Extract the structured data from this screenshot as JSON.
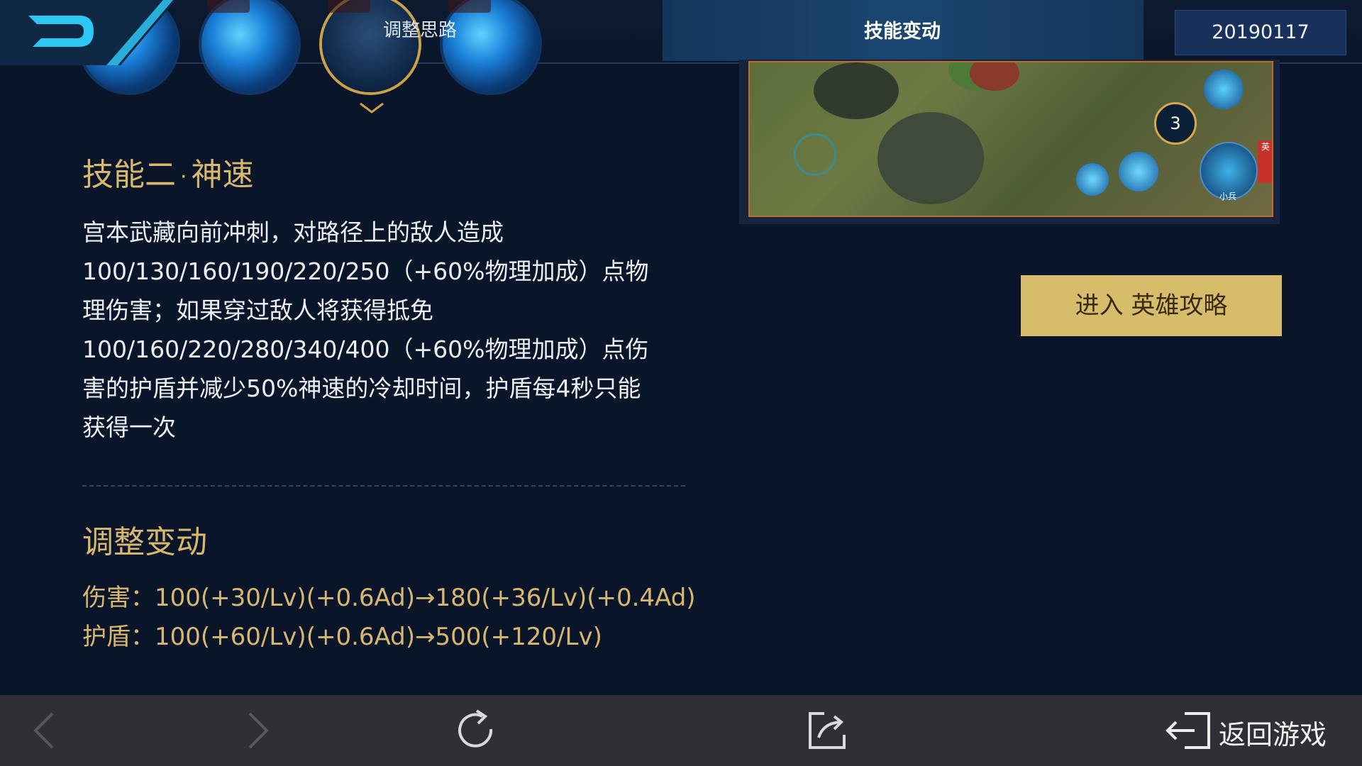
{
  "header": {
    "tabs": [
      {
        "label": "调整思路",
        "active": false
      },
      {
        "label": "技能变动",
        "active": true
      }
    ],
    "date": "20190117",
    "logo_icon": "d-logo-icon"
  },
  "skills_bar": {
    "icons": [
      "skill-1-icon",
      "skill-2-icon",
      "skill-3-icon",
      "skill-4-icon"
    ],
    "selected_index": 2
  },
  "skill": {
    "title": "技能二",
    "separator": "·",
    "name": "神速",
    "description_lines": [
      "宫本武藏向前冲刺，对路径上的敌人造成",
      "100/130/160/190/220/250（+60%物理加成）点物",
      "理伤害；如果穿过敌人将获得抵免",
      "100/160/220/280/340/400（+60%物理加成）点伤",
      "害的护盾并减少50%神速的冷却时间，护盾每4秒只能",
      "获得一次"
    ]
  },
  "adjustment": {
    "title": "调整变动",
    "lines": [
      "伤害：100(+30/Lv)(+0.6Ad)→180(+36/Lv)(+0.4Ad)",
      "护盾：100(+60/Lv)(+0.6Ad)→500(+120/Lv)"
    ]
  },
  "video": {
    "counter": "3",
    "label": "小兵",
    "side_label": "英"
  },
  "actions": {
    "enter_strategy": "进入 英雄攻略"
  },
  "bottom_nav": {
    "back_icon": "chevron-left-icon",
    "forward_icon": "chevron-right-icon",
    "refresh_icon": "refresh-icon",
    "share_icon": "share-icon",
    "return_icon": "exit-icon",
    "return_label": "返回游戏"
  },
  "colors": {
    "background": "#0b1529",
    "gold": "#d8b870",
    "button_gold": "#d7bc6c",
    "bottom_bar": "#2e3036"
  }
}
